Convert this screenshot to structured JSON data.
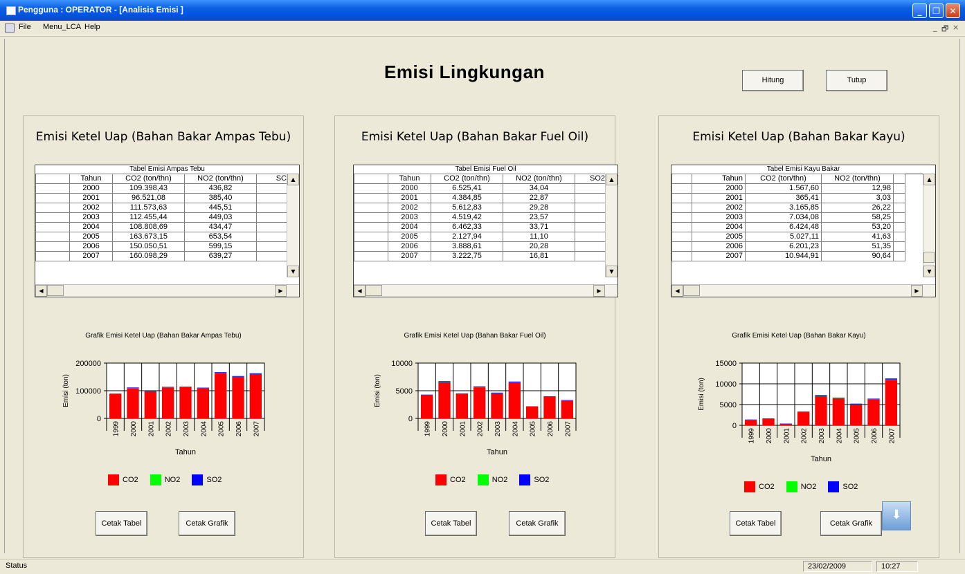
{
  "window": {
    "title": "Pengguna : OPERATOR - [Analisis Emisi ]"
  },
  "menu": {
    "items": [
      "File",
      "Menu_LCA",
      "Help"
    ],
    "mdi_controls": [
      "_",
      "̶",
      "×"
    ]
  },
  "main": {
    "title": "Emisi Lingkungan",
    "hitung_label": "Hitung",
    "tutup_label": "Tutup"
  },
  "panels": [
    {
      "title": "Emisi Ketel Uap (Bahan Bakar Ampas Tebu)",
      "table_caption": "Tabel Emisi Ampas Tebu",
      "columns": [
        "Tahun",
        "CO2 (ton/thn)",
        "NO2 (ton/thn)",
        "SC"
      ],
      "rows": [
        [
          "2000",
          "109.398,43",
          "436,82"
        ],
        [
          "2001",
          "96.521,08",
          "385,40"
        ],
        [
          "2002",
          "111.573,63",
          "445,51"
        ],
        [
          "2003",
          "112.455,44",
          "449,03"
        ],
        [
          "2004",
          "108.808,69",
          "434,47"
        ],
        [
          "2005",
          "163.673,15",
          "653,54"
        ],
        [
          "2006",
          "150.050,51",
          "599,15"
        ],
        [
          "2007",
          "160.098,29",
          "639,27"
        ]
      ],
      "chart_title": "Grafik Emisi Ketel Uap (Bahan Bakar Ampas Tebu)",
      "cetak_tabel": "Cetak Tabel",
      "cetak_grafik": "Cetak Grafik"
    },
    {
      "title": "Emisi Ketel Uap (Bahan Bakar Fuel Oil)",
      "table_caption": "Tabel Emisi Fuel Oil",
      "columns": [
        "Tahun",
        "CO2 (ton/thn)",
        "NO2 (ton/thn)",
        "SO2"
      ],
      "rows": [
        [
          "2000",
          "6.525,41",
          "34,04"
        ],
        [
          "2001",
          "4.384,85",
          "22,87"
        ],
        [
          "2002",
          "5.612,83",
          "29,28"
        ],
        [
          "2003",
          "4.519,42",
          "23,57"
        ],
        [
          "2004",
          "6.462,33",
          "33,71"
        ],
        [
          "2005",
          "2.127,94",
          "11,10"
        ],
        [
          "2006",
          "3.888,61",
          "20,28"
        ],
        [
          "2007",
          "3.222,75",
          "16,81"
        ]
      ],
      "chart_title": "Grafik Emisi Ketel Uap (Bahan Bakar Fuel Oil)",
      "cetak_tabel": "Cetak Tabel",
      "cetak_grafik": "Cetak Grafik"
    },
    {
      "title": "Emisi Ketel Uap (Bahan Bakar Kayu)",
      "table_caption": "Tabel Emisi Kayu Bakar",
      "columns": [
        "Tahun",
        "CO2 (ton/thn)",
        "NO2 (ton/thn)",
        ""
      ],
      "rows": [
        [
          "2000",
          "1.567,60",
          "12,98"
        ],
        [
          "2001",
          "365,41",
          "3,03"
        ],
        [
          "2002",
          "3.165,85",
          "26,22"
        ],
        [
          "2003",
          "7.034,08",
          "58,25"
        ],
        [
          "2004",
          "6.424,48",
          "53,20"
        ],
        [
          "2005",
          "5.027,11",
          "41,63"
        ],
        [
          "2006",
          "6.201,23",
          "51,35"
        ],
        [
          "2007",
          "10.944,91",
          "90,64"
        ]
      ],
      "chart_title": "Grafik Emisi Ketel Uap (Bahan Bakar Kayu)",
      "cetak_tabel": "Cetak Tabel",
      "cetak_grafik": "Cetak Grafik"
    }
  ],
  "legend": {
    "co2": "CO2",
    "no2": "NO2",
    "so2": "SO2"
  },
  "colors": {
    "co2": "#FF0000",
    "no2": "#00FF00",
    "so2": "#0000FF"
  },
  "chart_data": [
    {
      "type": "bar",
      "title": "",
      "xlabel": "Tahun",
      "ylabel": "Emisi (ton)",
      "ylim": [
        0,
        200000
      ],
      "yticks": [
        0,
        100000,
        200000
      ],
      "categories": [
        "1999",
        "2000",
        "2001",
        "2002",
        "2003",
        "2004",
        "2005",
        "2006",
        "2007"
      ],
      "series": [
        {
          "name": "CO2",
          "values": [
            88000,
            109398,
            96521,
            111574,
            112455,
            108809,
            163673,
            150051,
            160098
          ]
        },
        {
          "name": "NO2",
          "values": [
            350,
            437,
            385,
            446,
            449,
            434,
            654,
            599,
            639
          ]
        },
        {
          "name": "SO2",
          "values": [
            1500,
            1800,
            1600,
            1900,
            1900,
            1800,
            2700,
            2500,
            2600
          ]
        }
      ]
    },
    {
      "type": "bar",
      "title": "",
      "xlabel": "Tahun",
      "ylabel": "Emisi (ton)",
      "ylim": [
        0,
        10000
      ],
      "yticks": [
        0,
        5000,
        10000
      ],
      "categories": [
        "1999",
        "2000",
        "2001",
        "2002",
        "2003",
        "2004",
        "2005",
        "2006",
        "2007"
      ],
      "series": [
        {
          "name": "CO2",
          "values": [
            4150,
            6525,
            4385,
            5613,
            4519,
            6462,
            2128,
            3889,
            3223
          ]
        },
        {
          "name": "NO2",
          "values": [
            20,
            34,
            23,
            29,
            24,
            34,
            11,
            20,
            17
          ]
        },
        {
          "name": "SO2",
          "values": [
            120,
            160,
            110,
            140,
            110,
            160,
            50,
            100,
            80
          ]
        }
      ]
    },
    {
      "type": "bar",
      "title": "",
      "xlabel": "Tahun",
      "ylabel": "Emisi (ton)",
      "ylim": [
        0,
        15000
      ],
      "yticks": [
        0,
        5000,
        10000,
        15000
      ],
      "categories": [
        "1999",
        "2000",
        "2001",
        "2002",
        "2003",
        "2004",
        "2005",
        "2006",
        "2007"
      ],
      "series": [
        {
          "name": "CO2",
          "values": [
            1300,
            1568,
            365,
            3166,
            7034,
            6424,
            5027,
            6201,
            10945
          ]
        },
        {
          "name": "NO2",
          "values": [
            10,
            13,
            3,
            26,
            58,
            53,
            42,
            51,
            91
          ]
        },
        {
          "name": "SO2",
          "values": [
            80,
            90,
            60,
            120,
            200,
            180,
            150,
            170,
            250
          ]
        }
      ]
    }
  ],
  "status": {
    "left": "Status",
    "date": "23/02/2009",
    "time": "10:27"
  }
}
